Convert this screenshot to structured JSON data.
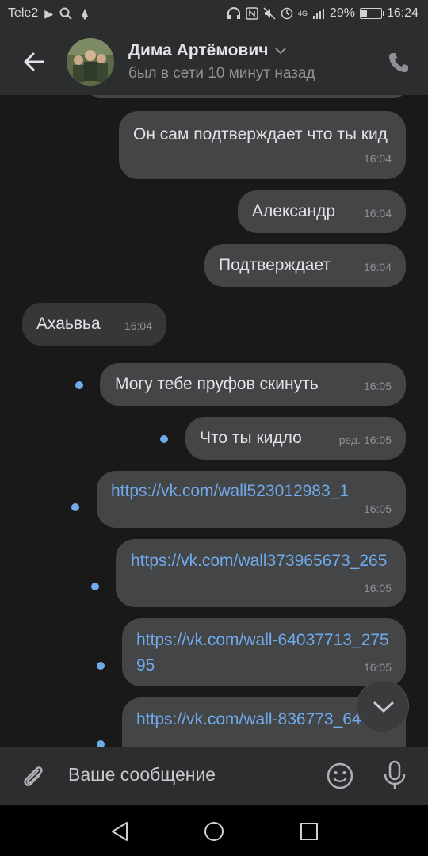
{
  "status_bar": {
    "carrier": "Tele2",
    "network": "4G",
    "battery": "29%",
    "battery_level": 0.29,
    "time": "16:24"
  },
  "header": {
    "contact_name": "Дима Артёмович",
    "status": "был в сети 10 минут назад",
    "icons": [
      "back-arrow-icon",
      "chevron-down-icon",
      "phone-icon"
    ]
  },
  "messages": [
    {
      "direction": "out",
      "text": "Он сам подтверждает что ты кид",
      "time": "16:04"
    },
    {
      "direction": "out",
      "text": "Александр",
      "time": "16:04"
    },
    {
      "direction": "out",
      "text": "Подтверждает",
      "time": "16:04"
    },
    {
      "direction": "in",
      "text": "Ахаьвьа",
      "time": "16:04"
    },
    {
      "direction": "out",
      "text": "Могу тебе пруфов скинуть",
      "time": "16:05",
      "unread": true
    },
    {
      "direction": "out",
      "text": "Что ты кидло",
      "time": "ред. 16:05",
      "unread": true
    },
    {
      "direction": "out",
      "text": "https://vk.com/wall523012983_1",
      "time": "16:05",
      "unread": true,
      "link": true
    },
    {
      "direction": "out",
      "text": "https://vk.com/wall373965673_265",
      "time": "16:05",
      "unread": true,
      "link": true
    },
    {
      "direction": "out",
      "text": "https://vk.com/wall-64037713_27595",
      "time": "16:05",
      "unread": true,
      "link": true
    },
    {
      "direction": "out",
      "text": "https://vk.com/wall-836773_6463",
      "time": "",
      "unread": true,
      "link": true
    }
  ],
  "compose": {
    "placeholder": "Ваше сообщение"
  },
  "colors": {
    "background": "#19191a",
    "header": "#2c2d2e",
    "bubble_out": "#444547",
    "bubble_in": "#363738",
    "link": "#71aaeb",
    "unread_dot": "#71aaeb"
  }
}
